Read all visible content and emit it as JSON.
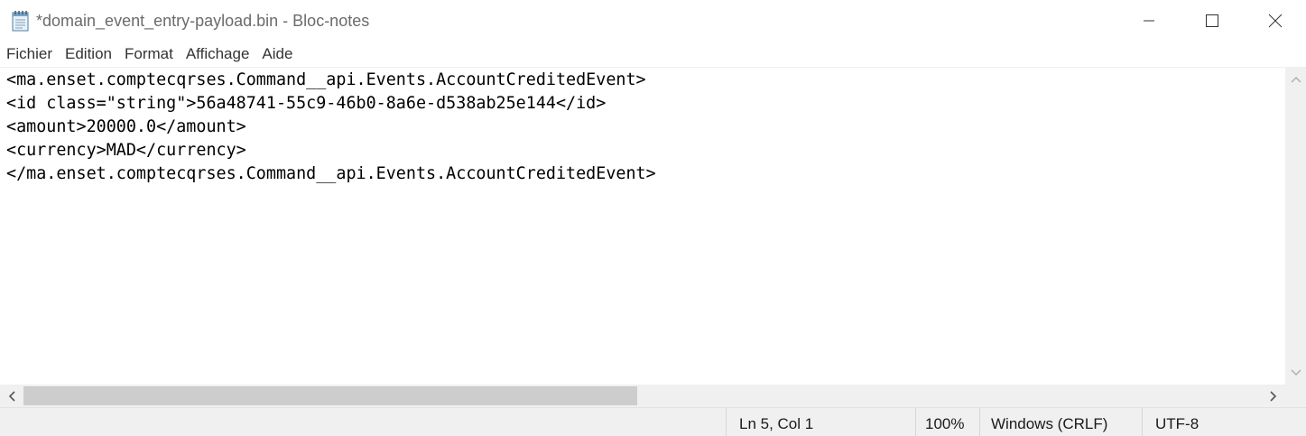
{
  "window": {
    "title": "*domain_event_entry-payload.bin - Bloc-notes",
    "icon": "notepad-icon"
  },
  "menu": {
    "items": [
      "Fichier",
      "Edition",
      "Format",
      "Affichage",
      "Aide"
    ]
  },
  "editor": {
    "lines": [
      "<ma.enset.comptecqrses.Command__api.Events.AccountCreditedEvent>",
      "<id class=\"string\">56a48741-55c9-46b0-8a6e-d538ab25e144</id>",
      "<amount>20000.0</amount>",
      "<currency>MAD</currency>",
      "</ma.enset.comptecqrses.Command__api.Events.AccountCreditedEvent>"
    ]
  },
  "statusbar": {
    "position": "Ln 5, Col 1",
    "zoom": "100%",
    "line_ending": "Windows (CRLF)",
    "encoding": "UTF-8"
  },
  "colors": {
    "chrome": "#f0f0f0",
    "text": "#000000",
    "scroll_thumb": "#cdcdcd"
  }
}
